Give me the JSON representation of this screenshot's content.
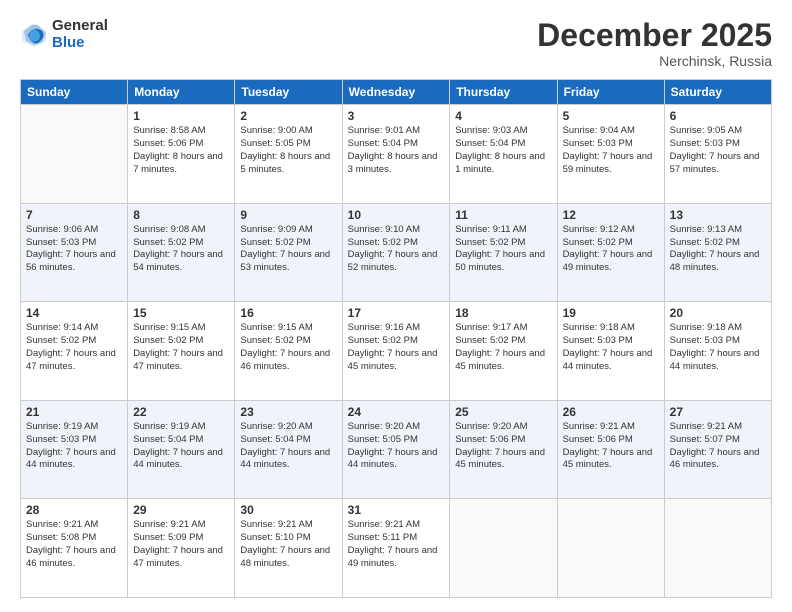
{
  "logo": {
    "general": "General",
    "blue": "Blue"
  },
  "title": "December 2025",
  "location": "Nerchinsk, Russia",
  "days_of_week": [
    "Sunday",
    "Monday",
    "Tuesday",
    "Wednesday",
    "Thursday",
    "Friday",
    "Saturday"
  ],
  "weeks": [
    [
      {
        "day": "",
        "sunrise": "",
        "sunset": "",
        "daylight": ""
      },
      {
        "day": "1",
        "sunrise": "Sunrise: 8:58 AM",
        "sunset": "Sunset: 5:06 PM",
        "daylight": "Daylight: 8 hours and 7 minutes."
      },
      {
        "day": "2",
        "sunrise": "Sunrise: 9:00 AM",
        "sunset": "Sunset: 5:05 PM",
        "daylight": "Daylight: 8 hours and 5 minutes."
      },
      {
        "day": "3",
        "sunrise": "Sunrise: 9:01 AM",
        "sunset": "Sunset: 5:04 PM",
        "daylight": "Daylight: 8 hours and 3 minutes."
      },
      {
        "day": "4",
        "sunrise": "Sunrise: 9:03 AM",
        "sunset": "Sunset: 5:04 PM",
        "daylight": "Daylight: 8 hours and 1 minute."
      },
      {
        "day": "5",
        "sunrise": "Sunrise: 9:04 AM",
        "sunset": "Sunset: 5:03 PM",
        "daylight": "Daylight: 7 hours and 59 minutes."
      },
      {
        "day": "6",
        "sunrise": "Sunrise: 9:05 AM",
        "sunset": "Sunset: 5:03 PM",
        "daylight": "Daylight: 7 hours and 57 minutes."
      }
    ],
    [
      {
        "day": "7",
        "sunrise": "Sunrise: 9:06 AM",
        "sunset": "Sunset: 5:03 PM",
        "daylight": "Daylight: 7 hours and 56 minutes."
      },
      {
        "day": "8",
        "sunrise": "Sunrise: 9:08 AM",
        "sunset": "Sunset: 5:02 PM",
        "daylight": "Daylight: 7 hours and 54 minutes."
      },
      {
        "day": "9",
        "sunrise": "Sunrise: 9:09 AM",
        "sunset": "Sunset: 5:02 PM",
        "daylight": "Daylight: 7 hours and 53 minutes."
      },
      {
        "day": "10",
        "sunrise": "Sunrise: 9:10 AM",
        "sunset": "Sunset: 5:02 PM",
        "daylight": "Daylight: 7 hours and 52 minutes."
      },
      {
        "day": "11",
        "sunrise": "Sunrise: 9:11 AM",
        "sunset": "Sunset: 5:02 PM",
        "daylight": "Daylight: 7 hours and 50 minutes."
      },
      {
        "day": "12",
        "sunrise": "Sunrise: 9:12 AM",
        "sunset": "Sunset: 5:02 PM",
        "daylight": "Daylight: 7 hours and 49 minutes."
      },
      {
        "day": "13",
        "sunrise": "Sunrise: 9:13 AM",
        "sunset": "Sunset: 5:02 PM",
        "daylight": "Daylight: 7 hours and 48 minutes."
      }
    ],
    [
      {
        "day": "14",
        "sunrise": "Sunrise: 9:14 AM",
        "sunset": "Sunset: 5:02 PM",
        "daylight": "Daylight: 7 hours and 47 minutes."
      },
      {
        "day": "15",
        "sunrise": "Sunrise: 9:15 AM",
        "sunset": "Sunset: 5:02 PM",
        "daylight": "Daylight: 7 hours and 47 minutes."
      },
      {
        "day": "16",
        "sunrise": "Sunrise: 9:15 AM",
        "sunset": "Sunset: 5:02 PM",
        "daylight": "Daylight: 7 hours and 46 minutes."
      },
      {
        "day": "17",
        "sunrise": "Sunrise: 9:16 AM",
        "sunset": "Sunset: 5:02 PM",
        "daylight": "Daylight: 7 hours and 45 minutes."
      },
      {
        "day": "18",
        "sunrise": "Sunrise: 9:17 AM",
        "sunset": "Sunset: 5:02 PM",
        "daylight": "Daylight: 7 hours and 45 minutes."
      },
      {
        "day": "19",
        "sunrise": "Sunrise: 9:18 AM",
        "sunset": "Sunset: 5:03 PM",
        "daylight": "Daylight: 7 hours and 44 minutes."
      },
      {
        "day": "20",
        "sunrise": "Sunrise: 9:18 AM",
        "sunset": "Sunset: 5:03 PM",
        "daylight": "Daylight: 7 hours and 44 minutes."
      }
    ],
    [
      {
        "day": "21",
        "sunrise": "Sunrise: 9:19 AM",
        "sunset": "Sunset: 5:03 PM",
        "daylight": "Daylight: 7 hours and 44 minutes."
      },
      {
        "day": "22",
        "sunrise": "Sunrise: 9:19 AM",
        "sunset": "Sunset: 5:04 PM",
        "daylight": "Daylight: 7 hours and 44 minutes."
      },
      {
        "day": "23",
        "sunrise": "Sunrise: 9:20 AM",
        "sunset": "Sunset: 5:04 PM",
        "daylight": "Daylight: 7 hours and 44 minutes."
      },
      {
        "day": "24",
        "sunrise": "Sunrise: 9:20 AM",
        "sunset": "Sunset: 5:05 PM",
        "daylight": "Daylight: 7 hours and 44 minutes."
      },
      {
        "day": "25",
        "sunrise": "Sunrise: 9:20 AM",
        "sunset": "Sunset: 5:06 PM",
        "daylight": "Daylight: 7 hours and 45 minutes."
      },
      {
        "day": "26",
        "sunrise": "Sunrise: 9:21 AM",
        "sunset": "Sunset: 5:06 PM",
        "daylight": "Daylight: 7 hours and 45 minutes."
      },
      {
        "day": "27",
        "sunrise": "Sunrise: 9:21 AM",
        "sunset": "Sunset: 5:07 PM",
        "daylight": "Daylight: 7 hours and 46 minutes."
      }
    ],
    [
      {
        "day": "28",
        "sunrise": "Sunrise: 9:21 AM",
        "sunset": "Sunset: 5:08 PM",
        "daylight": "Daylight: 7 hours and 46 minutes."
      },
      {
        "day": "29",
        "sunrise": "Sunrise: 9:21 AM",
        "sunset": "Sunset: 5:09 PM",
        "daylight": "Daylight: 7 hours and 47 minutes."
      },
      {
        "day": "30",
        "sunrise": "Sunrise: 9:21 AM",
        "sunset": "Sunset: 5:10 PM",
        "daylight": "Daylight: 7 hours and 48 minutes."
      },
      {
        "day": "31",
        "sunrise": "Sunrise: 9:21 AM",
        "sunset": "Sunset: 5:11 PM",
        "daylight": "Daylight: 7 hours and 49 minutes."
      },
      {
        "day": "",
        "sunrise": "",
        "sunset": "",
        "daylight": ""
      },
      {
        "day": "",
        "sunrise": "",
        "sunset": "",
        "daylight": ""
      },
      {
        "day": "",
        "sunrise": "",
        "sunset": "",
        "daylight": ""
      }
    ]
  ]
}
